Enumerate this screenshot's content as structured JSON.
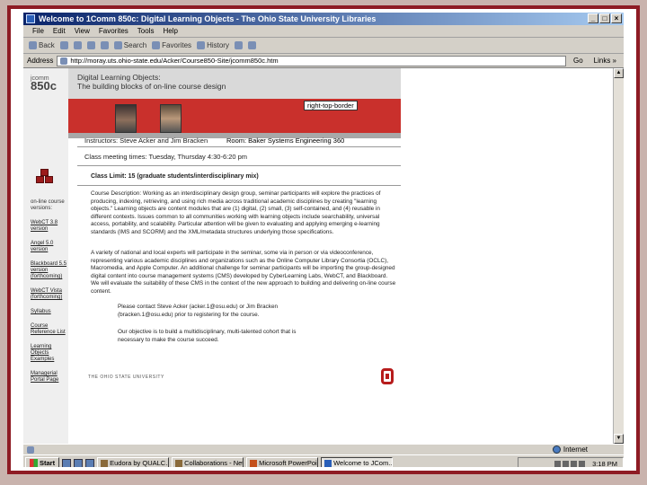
{
  "window": {
    "title": "Welcome to 1Comm 850c: Digital Learning Objects - The Ohio State University Libraries",
    "controls": [
      "_",
      "□",
      "×"
    ]
  },
  "menu": [
    "File",
    "Edit",
    "View",
    "Favorites",
    "Tools",
    "Help"
  ],
  "toolbar": {
    "back": "Back",
    "search": "Search",
    "favorites": "Favorites",
    "history": "History"
  },
  "address": {
    "label": "Address",
    "url": "http://moray.uts.ohio-state.edu/Acker/Course850-Site/jcomm850c.htm",
    "go": "Go",
    "links": "Links »"
  },
  "page": {
    "course_code_top": "jcomm",
    "course_code_num": "850c",
    "title_line1": "Digital Learning Objects:",
    "title_line2": "The building blocks of on-line course design",
    "css_label": "right-top-border",
    "instructors": "Instructors: Steve Acker and Jim Bracken",
    "room": "Room: Baker Systems Engineering 360",
    "meeting": "Class meeting times: Tuesday, Thursday 4:30-6:20 pm",
    "limit": "Class Limit: 15 (graduate students/interdisciplinary mix)",
    "description": "Course Description: Working as an interdisciplinary design group, seminar participants will explore the practices of producing, indexing, retrieving, and using rich media across traditional academic disciplines by creating \"learning objects.\" Learning objects are content modules that are (1) digital, (2) small, (3) self-contained, and (4) reusable in different contexts. Issues common to all communities working with learning objects include searchability, universal access, portability, and scalability. Particular attention will be given to evaluating and applying emerging e-learning standards (IMS and SCORM) and the XML/metadata structures underlying those specifications.",
    "experts": "A variety of national and local experts will participate in the seminar, some via in person or via videoconference, representing various academic disciplines and organizations such as the Online Computer Library Consortia (OCLC), Macromedia, and Apple Computer. An additional challenge for seminar participants will be importing the group-designed digital content into course management systems (CMS) developed by CyberLearning Labs, WebCT, and Blackboard. We will evaluate the suitability of these CMS in the context of the new approach to building and delivering on-line course content.",
    "contact": "Please contact Steve Acker (acker.1@osu.edu) or Jim Bracken (bracken.1@osu.edu) prior to registering for the course.",
    "objective": "Our objective is to build a multidisciplinary, multi-talented cohort that is necessary to make the course succeed.",
    "osu_footer": "THE OHIO STATE UNIVERSITY"
  },
  "sidebar": [
    {
      "label": "on-line course versions:",
      "link": false
    },
    {
      "label": "WebCT 3.8 version",
      "link": true
    },
    {
      "label": "Angel 5.0 version",
      "link": true
    },
    {
      "label": "Blackboard 5.5 version (forthcoming)",
      "link": true
    },
    {
      "label": "WebCT Vista (forthcoming)",
      "link": true
    },
    {
      "label": "Syllabus",
      "link": true
    },
    {
      "label": "Course Reference List",
      "link": true
    },
    {
      "label": "Learning Objects Examples",
      "link": true
    },
    {
      "label": "Managerial Portal Page",
      "link": true
    }
  ],
  "status": {
    "zone": "Internet"
  },
  "taskbar": {
    "start": "Start",
    "tasks": [
      {
        "label": "Eudora by QUALC...",
        "active": false
      },
      {
        "label": "Collaborations - Net...",
        "active": false
      },
      {
        "label": "Microsoft PowerPoi...",
        "active": false
      },
      {
        "label": "Welcome to JCom...",
        "active": true
      }
    ],
    "clock": "3:18 PM"
  }
}
